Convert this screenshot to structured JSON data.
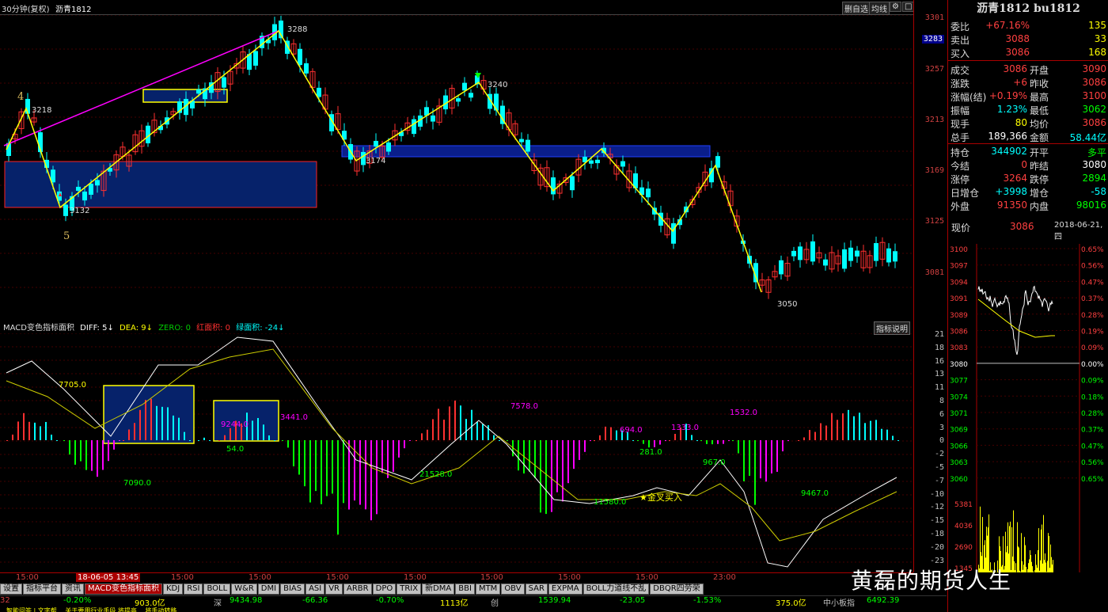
{
  "topbar": {
    "timeframe": "30分钟(复权)",
    "symbol": "沥青1812",
    "btn_delete": "删自选",
    "btn_ma": "均线",
    "btn_settings": "⚙",
    "btn_close": "□"
  },
  "main": {
    "yticks": [
      "3301",
      "3283",
      "3257",
      "3213",
      "3169",
      "3125",
      "3081"
    ],
    "current_price_tag": "3283",
    "annotations": [
      {
        "t": "3288"
      },
      {
        "t": "3218"
      },
      {
        "t": "3240"
      },
      {
        "t": "3174"
      },
      {
        "t": "3132"
      },
      {
        "t": "3050"
      },
      {
        "t": "4"
      },
      {
        "t": "5"
      }
    ]
  },
  "macd": {
    "title": "MACD变色指标面积",
    "diff_label": "DIFF: 5↓",
    "dea_label": "DEA: 9↓",
    "zero_label": "ZERO: 0",
    "red_label": "红面积: 0",
    "green_label": "绿面积: -24↓",
    "btn_explain": "指标说明",
    "yticks": [
      "21",
      "18",
      "16",
      "13",
      "11",
      "8",
      "6",
      "3",
      "0",
      "-2",
      "-5",
      "-7",
      "-10",
      "-12",
      "-15",
      "-18",
      "-20",
      "-23"
    ],
    "areas": [
      {
        "t": "7705.0",
        "c": "#ffff00"
      },
      {
        "t": "7090.0",
        "c": "#00ff00"
      },
      {
        "t": "9244.0",
        "c": "#ff00ff"
      },
      {
        "t": "54.0",
        "c": "#00ff00"
      },
      {
        "t": "3441.0",
        "c": "#ff00ff"
      },
      {
        "t": "21528.0",
        "c": "#00ff00"
      },
      {
        "t": "7578.0",
        "c": "#ff00ff"
      },
      {
        "t": "694.0",
        "c": "#ff00ff"
      },
      {
        "t": "281.0",
        "c": "#00ff00"
      },
      {
        "t": "1333.0",
        "c": "#ff00ff"
      },
      {
        "t": "967.0",
        "c": "#00ff00"
      },
      {
        "t": "1532.0",
        "c": "#ff00ff"
      },
      {
        "t": "11580.0",
        "c": "#00ff00"
      },
      {
        "t": "9467.0",
        "c": "#00ff00"
      }
    ],
    "golden_cross": "★金叉买入"
  },
  "time_labels": [
    "15:00",
    "18-06-05 13:45",
    "15:00",
    "15:00",
    "15:00",
    "15:00",
    "15:00",
    "15:00",
    "15:00",
    "23:00"
  ],
  "tabs": [
    "设置",
    "指标平台",
    "资讯",
    "MACD变色指标面积",
    "KDJ",
    "RSI",
    "BOLL",
    "W&R",
    "DMI",
    "BIAS",
    "ASI",
    "VR",
    "ARBR",
    "DPO",
    "TRIX",
    "新DMA",
    "BBI",
    "MTM",
    "OBV",
    "SAR",
    "EXPMA",
    "BOLL力道线不乱",
    "DBQR四劳荣"
  ],
  "status": [
    {
      "t": "32",
      "c": "#d04040"
    },
    {
      "t": "-0.20%",
      "c": "#00ff00"
    },
    {
      "t": "903.0亿",
      "c": "#ffff00"
    },
    {
      "t": "深",
      "c": "#c0c0c0"
    },
    {
      "t": "9434.98",
      "c": "#00ff00"
    },
    {
      "t": "-66.36",
      "c": "#00ff00"
    },
    {
      "t": "-0.70%",
      "c": "#00ff00"
    },
    {
      "t": "1113亿",
      "c": "#ffff00"
    },
    {
      "t": "创",
      "c": "#c0c0c0"
    },
    {
      "t": "1539.94",
      "c": "#00ff00"
    },
    {
      "t": "-23.05",
      "c": "#00ff00"
    },
    {
      "t": "-1.53%",
      "c": "#00ff00"
    },
    {
      "t": "375.0亿",
      "c": "#ffff00"
    },
    {
      "t": "中小板指",
      "c": "#c0c0c0"
    },
    {
      "t": "6492.39",
      "c": "#00ff00"
    }
  ],
  "ticker": "…智能问答 | 文字帮… 关于要用行业手段 将提高… 将手动转移 …",
  "panel": {
    "title": "沥青1812 bu1812",
    "rows": [
      {
        "l": "委比",
        "v": "+67.16%",
        "v2": "135",
        "vc": "#ff4040",
        "v2c": "#ffff00"
      },
      {
        "l": "卖出",
        "v": "3088",
        "v2": "33",
        "vc": "#ff4040",
        "v2c": "#ffff00"
      },
      {
        "l": "买入",
        "v": "3086",
        "v2": "168",
        "vc": "#ff4040",
        "v2c": "#ffff00"
      }
    ],
    "quote": [
      {
        "l": "成交",
        "v": "3086",
        "l2": "开盘",
        "v2": "3090",
        "vc": "#ff4040",
        "v2c": "#ff4040"
      },
      {
        "l": "涨跌",
        "v": "+6",
        "l2": "昨收",
        "v2": "3086",
        "vc": "#ff4040",
        "v2c": "#ff4040"
      },
      {
        "l": "涨幅(结)",
        "v": "+0.19%",
        "l2": "最高",
        "v2": "3100",
        "vc": "#ff4040",
        "v2c": "#ff4040"
      },
      {
        "l": "振幅",
        "v": "1.23%",
        "l2": "最低",
        "v2": "3062",
        "vc": "#00ffff",
        "v2c": "#00ff00"
      },
      {
        "l": "现手",
        "v": "80",
        "l2": "均价",
        "v2": "3086",
        "vc": "#ffff00",
        "v2c": "#ff4040"
      },
      {
        "l": "总手",
        "v": "189,366",
        "l2": "金额",
        "v2": "58.44亿",
        "vc": "#ffffff",
        "v2c": "#00ffff"
      },
      {
        "l": "持仓",
        "v": "344902",
        "l2": "开平",
        "v2": "多平",
        "vc": "#00ffff",
        "v2c": "#00ff00"
      },
      {
        "l": "今结",
        "v": "0",
        "l2": "昨结",
        "v2": "3080",
        "vc": "#ff4040",
        "v2c": "#ffffff"
      },
      {
        "l": "涨停",
        "v": "3264",
        "l2": "跌停",
        "v2": "2894",
        "vc": "#ff4040",
        "v2c": "#00ff00"
      },
      {
        "l": "日增仓",
        "v": "+3998",
        "l2": "增仓",
        "v2": "-58",
        "vc": "#00ffff",
        "v2c": "#00ffff"
      },
      {
        "l": "外盘",
        "v": "91350",
        "l2": "内盘",
        "v2": "98016",
        "vc": "#ff4040",
        "v2c": "#00ff00"
      }
    ],
    "now_label": "现价",
    "now_value": "3086",
    "date": "2018-06-21,四",
    "mini_left": [
      "3100",
      "3097",
      "3094",
      "3091",
      "3089",
      "3086",
      "3083",
      "3080",
      "3077",
      "3074",
      "3071",
      "3069",
      "3066",
      "3063",
      "3060"
    ],
    "mini_right": [
      "0.65%",
      "0.56%",
      "0.47%",
      "0.37%",
      "0.28%",
      "0.19%",
      "0.09%",
      "0.00%",
      "0.09%",
      "0.18%",
      "0.28%",
      "0.37%",
      "0.47%",
      "0.56%",
      "0.65%"
    ],
    "vol_labels": [
      "5381",
      "4036",
      "2690",
      "1345"
    ]
  },
  "watermark": "黄磊的期货人生"
}
